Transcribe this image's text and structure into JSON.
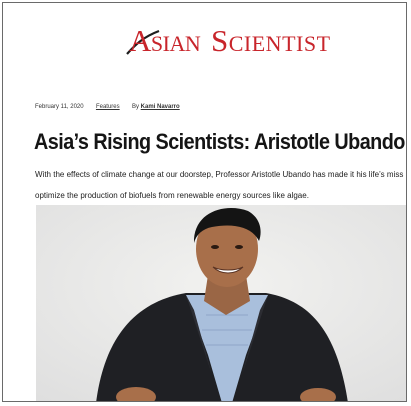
{
  "brand": {
    "name_part1": "Asian",
    "name_part2": "Scientist",
    "accent_color": "#c8252b"
  },
  "article": {
    "date": "February 11, 2020",
    "category": "Features",
    "byline_prefix": "By",
    "author": "Kami Navarro",
    "title": "Asia’s Rising Scientists: Aristotle Ubando",
    "summary_line1": "With the effects of climate change at our doorstep, Professor Aristotle Ubando has made it his life’s miss",
    "summary_line2": "optimize the production of biofuels from renewable energy sources like algae."
  },
  "photo": {
    "icon": "portrait-photo"
  }
}
